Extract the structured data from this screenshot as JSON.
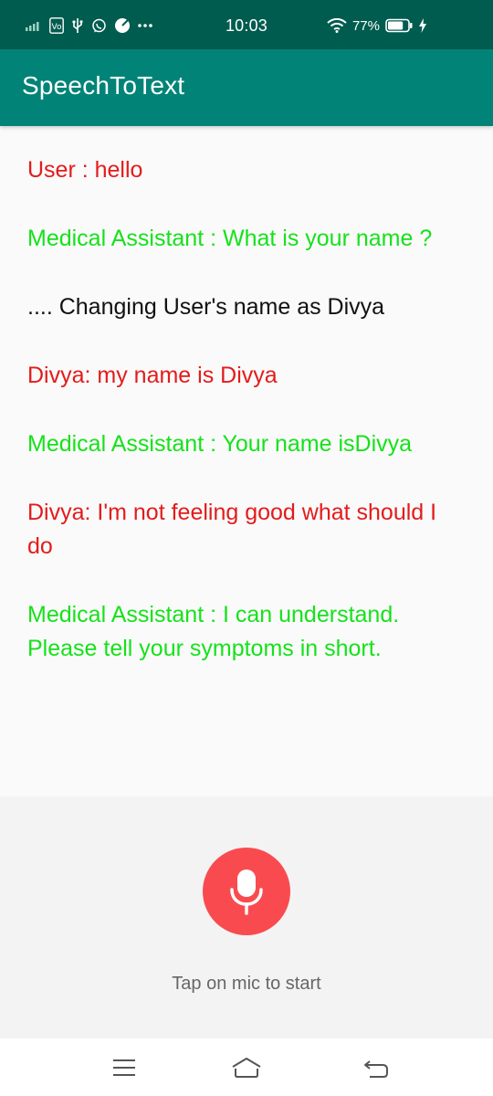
{
  "status_bar": {
    "time": "10:03",
    "battery_percent": "77%",
    "battery_level": 0.77,
    "left_icons": [
      "signal-bars-icon",
      "volte-icon",
      "usb-icon",
      "whatsapp-icon",
      "pie-icon",
      "more-dots-icon"
    ],
    "right_icons": [
      "wifi-icon",
      "battery-icon",
      "charging-icon"
    ]
  },
  "app_bar": {
    "title": "SpeechToText"
  },
  "conversation": [
    {
      "role": "user",
      "text": "User : hello"
    },
    {
      "role": "assistant",
      "text": "Medical Assistant : What is your name ?"
    },
    {
      "role": "system",
      "text": ".... Changing User's name as Divya"
    },
    {
      "role": "user",
      "text": "Divya: my name is Divya"
    },
    {
      "role": "assistant",
      "text": "Medical Assistant : Your name isDivya"
    },
    {
      "role": "user",
      "text": "Divya: I'm not feeling good what should I do"
    },
    {
      "role": "assistant",
      "text": "Medical Assistant : I can understand. Please tell your symptoms in short."
    }
  ],
  "bottom_panel": {
    "mic_icon": "microphone-icon",
    "hint": "Tap on mic to start"
  },
  "nav_bar": {
    "icons": [
      "menu-icon",
      "home-icon",
      "back-icon"
    ]
  },
  "colors": {
    "status_bar": "#005c4f",
    "app_bar": "#018477",
    "user_text": "#e41b1b",
    "assistant_text": "#15e21a",
    "system_text": "#111111",
    "mic_button": "#f94b4f"
  }
}
